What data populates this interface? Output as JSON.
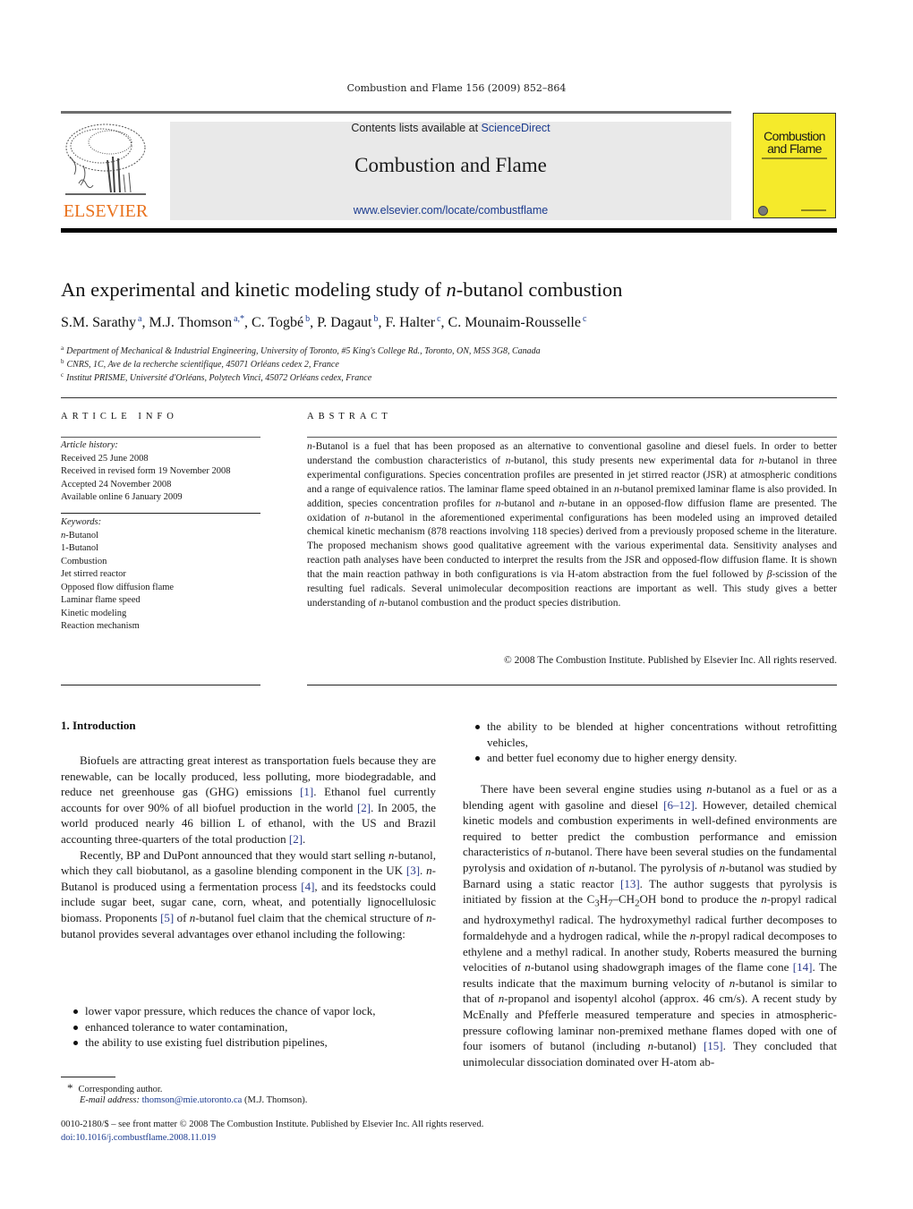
{
  "running_head": "Combustion and Flame 156 (2009) 852–864",
  "banner": {
    "contents_prefix": "Contents lists available at ",
    "contents_link": "ScienceDirect",
    "journal_title": "Combustion and Flame",
    "journal_url": "www.elsevier.com/locate/combustflame",
    "publisher": "ELSEVIER",
    "cover_title_line1": "Combustion",
    "cover_title_line2": "and Flame",
    "colors": {
      "publisher_orange": "#e9711c",
      "cover_yellow": "#f5ea2b",
      "link_blue": "#1b3b8f",
      "banner_gray": "#e9e9e9"
    }
  },
  "article": {
    "title_before": "An experimental and kinetic modeling study of ",
    "title_italic": "n",
    "title_after": "-butanol combustion",
    "authors": [
      {
        "name": "S.M. Sarathy",
        "sup": "a",
        "sep": ", "
      },
      {
        "name": "M.J. Thomson",
        "sup": "a,*",
        "sep": ", "
      },
      {
        "name": "C. Togbé",
        "sup": "b",
        "sep": ", "
      },
      {
        "name": "P. Dagaut",
        "sup": "b",
        "sep": ", "
      },
      {
        "name": "F. Halter",
        "sup": "c",
        "sep": ", "
      },
      {
        "name": "C. Mounaim-Rousselle",
        "sup": "c",
        "sep": ""
      }
    ],
    "affiliations": [
      {
        "mark": "a",
        "text": "Department of Mechanical & Industrial Engineering, University of Toronto, #5 King's College Rd., Toronto, ON, M5S 3G8, Canada"
      },
      {
        "mark": "b",
        "text": "CNRS, 1C, Ave de la recherche scientifique, 45071 Orléans cedex 2, France"
      },
      {
        "mark": "c",
        "text": "Institut PRISME, Université d'Orléans, Polytech Vinci, 45072 Orléans cedex, France"
      }
    ]
  },
  "article_info": {
    "heading": "ARTICLE INFO",
    "history_label": "Article history:",
    "history": [
      "Received 25 June 2008",
      "Received in revised form 19 November 2008",
      "Accepted 24 November 2008",
      "Available online 6 January 2009"
    ],
    "keywords_label": "Keywords:",
    "keywords": [
      "n-Butanol",
      "1-Butanol",
      "Combustion",
      "Jet stirred reactor",
      "Opposed flow diffusion flame",
      "Laminar flame speed",
      "Kinetic modeling",
      "Reaction mechanism"
    ]
  },
  "abstract": {
    "heading": "ABSTRACT",
    "text": "n-Butanol is a fuel that has been proposed as an alternative to conventional gasoline and diesel fuels. In order to better understand the combustion characteristics of n-butanol, this study presents new experimental data for n-butanol in three experimental configurations. Species concentration profiles are presented in jet stirred reactor (JSR) at atmospheric conditions and a range of equivalence ratios. The laminar flame speed obtained in an n-butanol premixed laminar flame is also provided. In addition, species concentration profiles for n-butanol and n-butane in an opposed-flow diffusion flame are presented. The oxidation of n-butanol in the aforementioned experimental configurations has been modeled using an improved detailed chemical kinetic mechanism (878 reactions involving 118 species) derived from a previously proposed scheme in the literature. The proposed mechanism shows good qualitative agreement with the various experimental data. Sensitivity analyses and reaction path analyses have been conducted to interpret the results from the JSR and opposed-flow diffusion flame. It is shown that the main reaction pathway in both configurations is via H-atom abstraction from the fuel followed by β-scission of the resulting fuel radicals. Several unimolecular decomposition reactions are important as well. This study gives a better understanding of n-butanol combustion and the product species distribution.",
    "copyright": "© 2008 The Combustion Institute. Published by Elsevier Inc. All rights reserved."
  },
  "body": {
    "section_heading": "1.  Introduction",
    "left_paragraphs": [
      "Biofuels are attracting great interest as transportation fuels because they are renewable, can be locally produced, less polluting, more biodegradable, and reduce net greenhouse gas (GHG) emissions [1]. Ethanol fuel currently accounts for over 90% of all biofuel production in the world [2]. In 2005, the world produced nearly 46 billion L of ethanol, with the US and Brazil accounting three-quarters of the total production [2].",
      "Recently, BP and DuPont announced that they would start selling n-butanol, which they call biobutanol, as a gasoline blending component in the UK [3]. n-Butanol is produced using a fermentation process [4], and its feedstocks could include sugar beet, sugar cane, corn, wheat, and potentially lignocellulosic biomass. Proponents [5] of n-butanol fuel claim that the chemical structure of n-butanol provides several advantages over ethanol including the following:"
    ],
    "left_bullets": [
      "lower vapor pressure, which reduces the chance of vapor lock,",
      "enhanced tolerance to water contamination,",
      "the ability to use existing fuel distribution pipelines,"
    ],
    "right_bullets": [
      "the ability to be blended at higher concentrations without retrofitting vehicles,",
      "and better fuel economy due to higher energy density."
    ],
    "right_paragraphs": [
      "There have been several engine studies using n-butanol as a fuel or as a blending agent with gasoline and diesel [6–12]. However, detailed chemical kinetic models and combustion experiments in well-defined environments are required to better predict the combustion performance and emission characteristics of n-butanol. There have been several studies on the fundamental pyrolysis and oxidation of n-butanol. The pyrolysis of n-butanol was studied by Barnard using a static reactor [13]. The author suggests that pyrolysis is initiated by fission at the C3H7–CH2OH bond to produce the n-propyl radical and hydroxymethyl radical. The hydroxymethyl radical further decomposes to formaldehyde and a hydrogen radical, while the n-propyl radical decomposes to ethylene and a methyl radical. In another study, Roberts measured the burning velocities of n-butanol using shadowgraph images of the flame cone [14]. The results indicate that the maximum burning velocity of n-butanol is similar to that of n-propanol and isopentyl alcohol (approx. 46 cm/s). A recent study by McEnally and Pfefferle measured temperature and species in atmospheric-pressure coflowing laminar non-premixed methane flames doped with one of four isomers of butanol (including n-butanol) [15]. They concluded that unimolecular dissociation dominated over H-atom ab-"
    ]
  },
  "footnotes": {
    "star": "*",
    "corresponding": "Corresponding author.",
    "email_label": "E-mail address:",
    "email": "thomson@mie.utoronto.ca",
    "email_suffix": " (M.J. Thomson).",
    "front_matter": "0010-2180/$ – see front matter  © 2008 The Combustion Institute. Published by Elsevier Inc. All rights reserved.",
    "doi": "doi:10.1016/j.combustflame.2008.11.019"
  }
}
